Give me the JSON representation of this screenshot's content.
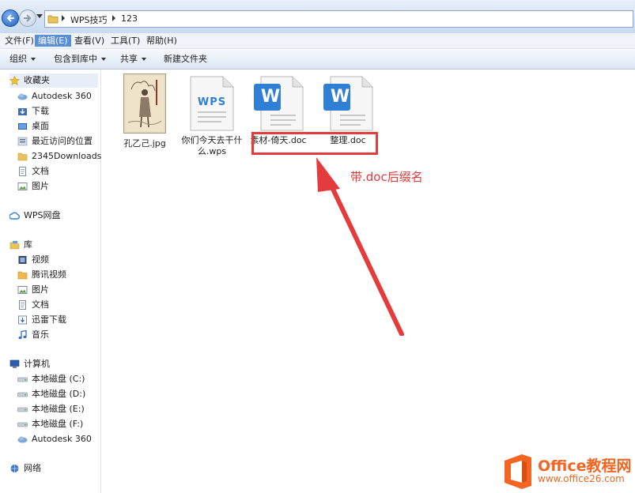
{
  "address": {
    "breadcrumbs": [
      "WPS技巧",
      "123"
    ]
  },
  "menu": [
    "文件(F)",
    "编辑(E)",
    "查看(V)",
    "工具(T)",
    "帮助(H)"
  ],
  "toolbar": [
    "组织",
    "包含到库中",
    "共享",
    "新建文件夹"
  ],
  "sidebar": {
    "favorites": {
      "header": "收藏夹",
      "items": [
        "Autodesk 360",
        "下载",
        "桌面",
        "最近访问的位置",
        "2345Downloads",
        "文档",
        "图片"
      ]
    },
    "wps": {
      "header": "WPS网盘"
    },
    "library": {
      "header": "库",
      "items": [
        "视频",
        "腾讯视频",
        "图片",
        "文档",
        "迅雷下载",
        "音乐"
      ]
    },
    "computer": {
      "header": "计算机",
      "items": [
        "本地磁盘 (C:)",
        "本地磁盘 (D:)",
        "本地磁盘 (E:)",
        "本地磁盘 (F:)",
        "Autodesk 360"
      ]
    },
    "network": {
      "header": "网络"
    }
  },
  "files": [
    {
      "name": "孔乙己.jpg",
      "type": "jpg"
    },
    {
      "name_line1": "你们今天去干什",
      "name_line2": "么.wps",
      "type": "wps",
      "icon_text": "WPS"
    },
    {
      "name": "素材-倚天.doc",
      "type": "doc",
      "icon_text": "W"
    },
    {
      "name": "整理.doc",
      "type": "doc",
      "icon_text": "W"
    }
  ],
  "annotation": {
    "text": "带.doc后缀名",
    "color": "#e03a3a"
  },
  "brand": {
    "name": "Office教程网",
    "url": "www.office26.com"
  },
  "colors": {
    "wps_blue": "#2f7fd6",
    "accent": "#5a8fd6",
    "annotation": "#e43c3c",
    "brand_orange": "#f26522"
  }
}
